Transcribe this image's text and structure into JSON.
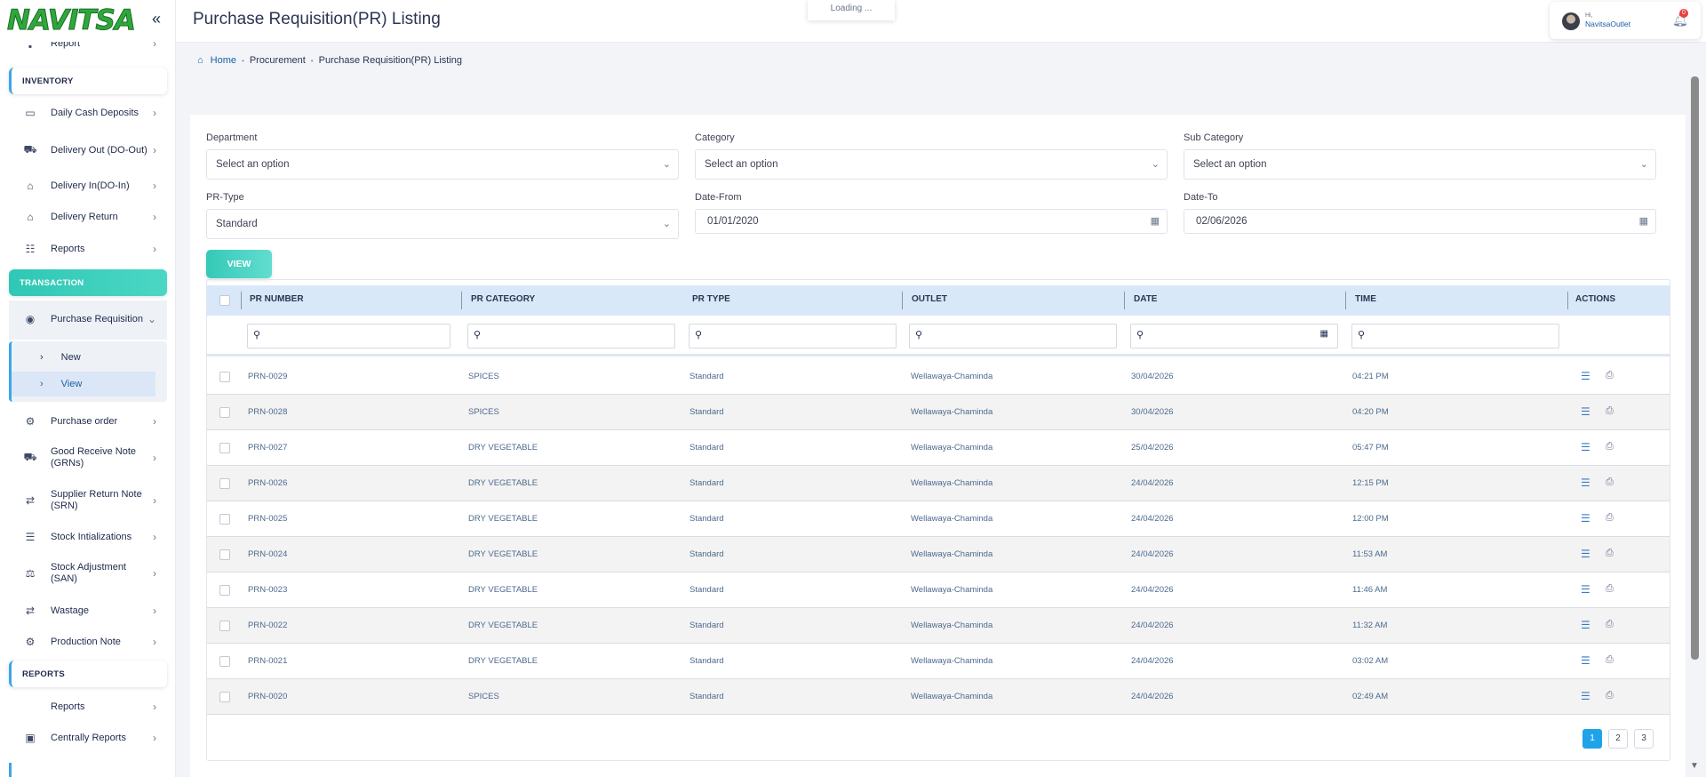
{
  "app": {
    "logo": "NAVITSA"
  },
  "header": {
    "title": "Purchase Requisition(PR) Listing",
    "loading": "Loading ...",
    "user_greeting": "Hi,",
    "user_name": "NavitsaOutlet",
    "notification_count": "0"
  },
  "breadcrumb": {
    "home": "Home",
    "section": "Procurement",
    "page": "Purchase Requisition(PR) Listing"
  },
  "sidebar": {
    "top_item": "Report",
    "sections": {
      "inventory": "INVENTORY",
      "transaction": "TRANSACTION",
      "reports": "REPORTS"
    },
    "inventory_items": [
      {
        "label": "Daily Cash Deposits",
        "icon": "cash-icon"
      },
      {
        "label": "Delivery Out (DO-Out)",
        "icon": "truck-icon"
      },
      {
        "label": "Delivery In(DO-In)",
        "icon": "inbox-icon"
      },
      {
        "label": "Delivery Return",
        "icon": "inbox-icon"
      },
      {
        "label": "Reports",
        "icon": "users-icon"
      }
    ],
    "transaction_items": [
      {
        "label": "Purchase Requisition",
        "icon": "circle-icon"
      },
      {
        "label": "Purchase order",
        "icon": "gear-icon"
      },
      {
        "label": "Good Receive Note (GRNs)",
        "icon": "truck-icon"
      },
      {
        "label": "Supplier Return Note (SRN)",
        "icon": "repeat-icon"
      },
      {
        "label": "Stock Intializations",
        "icon": "database-icon"
      },
      {
        "label": "Stock Adjustment (SAN)",
        "icon": "scale-icon"
      },
      {
        "label": "Wastage",
        "icon": "repeat-icon"
      },
      {
        "label": "Production Note",
        "icon": "gears-icon"
      }
    ],
    "pr_sub_items": [
      "New",
      "View"
    ],
    "report_items": [
      {
        "label": "Reports",
        "icon": ""
      },
      {
        "label": "Centrally Reports",
        "icon": "book-icon"
      }
    ]
  },
  "filters": {
    "department": {
      "label": "Department",
      "value": "Select an option"
    },
    "category": {
      "label": "Category",
      "value": "Select an option"
    },
    "sub_category": {
      "label": "Sub Category",
      "value": "Select an option"
    },
    "pr_type": {
      "label": "PR-Type",
      "value": "Standard"
    },
    "date_from": {
      "label": "Date-From",
      "value": "01/01/2020"
    },
    "date_to": {
      "label": "Date-To",
      "value": "02/06/2026"
    },
    "view_button": "VIEW"
  },
  "table": {
    "columns": [
      "PR NUMBER",
      "PR CATEGORY",
      "PR TYPE",
      "OUTLET",
      "DATE",
      "TIME",
      "ACTIONS"
    ],
    "rows": [
      {
        "pr_number": "PRN-0029",
        "category": "SPICES",
        "type": "Standard",
        "outlet": "Wellawaya-Chaminda",
        "date": "30/04/2026",
        "time": "04:21 PM"
      },
      {
        "pr_number": "PRN-0028",
        "category": "SPICES",
        "type": "Standard",
        "outlet": "Wellawaya-Chaminda",
        "date": "30/04/2026",
        "time": "04:20 PM"
      },
      {
        "pr_number": "PRN-0027",
        "category": "DRY VEGETABLE",
        "type": "Standard",
        "outlet": "Wellawaya-Chaminda",
        "date": "25/04/2026",
        "time": "05:47 PM"
      },
      {
        "pr_number": "PRN-0026",
        "category": "DRY VEGETABLE",
        "type": "Standard",
        "outlet": "Wellawaya-Chaminda",
        "date": "24/04/2026",
        "time": "12:15 PM"
      },
      {
        "pr_number": "PRN-0025",
        "category": "DRY VEGETABLE",
        "type": "Standard",
        "outlet": "Wellawaya-Chaminda",
        "date": "24/04/2026",
        "time": "12:00 PM"
      },
      {
        "pr_number": "PRN-0024",
        "category": "DRY VEGETABLE",
        "type": "Standard",
        "outlet": "Wellawaya-Chaminda",
        "date": "24/04/2026",
        "time": "11:53 AM"
      },
      {
        "pr_number": "PRN-0023",
        "category": "DRY VEGETABLE",
        "type": "Standard",
        "outlet": "Wellawaya-Chaminda",
        "date": "24/04/2026",
        "time": "11:46 AM"
      },
      {
        "pr_number": "PRN-0022",
        "category": "DRY VEGETABLE",
        "type": "Standard",
        "outlet": "Wellawaya-Chaminda",
        "date": "24/04/2026",
        "time": "11:32 AM"
      },
      {
        "pr_number": "PRN-0021",
        "category": "DRY VEGETABLE",
        "type": "Standard",
        "outlet": "Wellawaya-Chaminda",
        "date": "24/04/2026",
        "time": "03:02 AM"
      },
      {
        "pr_number": "PRN-0020",
        "category": "SPICES",
        "type": "Standard",
        "outlet": "Wellawaya-Chaminda",
        "date": "24/04/2026",
        "time": "02:49 AM"
      }
    ]
  },
  "pagination": {
    "pages": [
      "1",
      "2",
      "3"
    ],
    "current": "1"
  },
  "colors": {
    "accent": "#35c9b6",
    "header_row": "#d9e8f8",
    "link": "#1b5fa8",
    "page_active": "#1fa3e8"
  }
}
